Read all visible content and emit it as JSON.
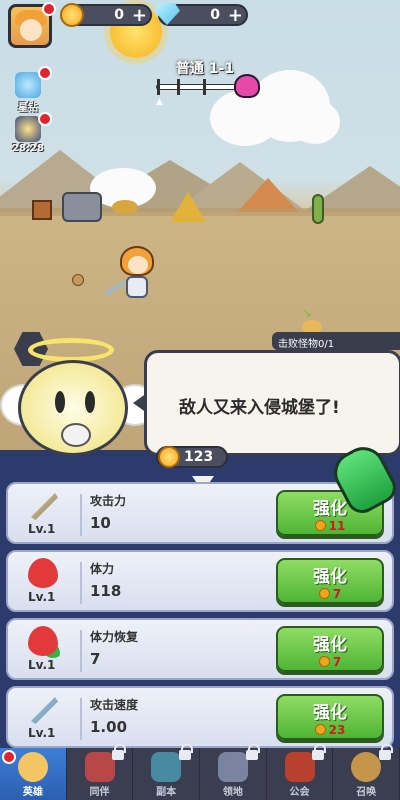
{
  "hud": {
    "gold": "0",
    "gems": "0",
    "stage": "普通 1-1",
    "side_buttons": [
      {
        "label": "星钻"
      },
      {
        "label": "28:28"
      }
    ],
    "kill_progress": "击败怪物0/1"
  },
  "dialog": {
    "text": "敌人又来入侵城堡了!"
  },
  "panel": {
    "coin_total": "123",
    "rows": [
      {
        "icon": "sword-icon",
        "level": "Lv.1",
        "name": "攻击力",
        "value": "10",
        "button": "强化",
        "cost": "11"
      },
      {
        "icon": "heart-icon",
        "level": "Lv.1",
        "name": "体力",
        "value": "118",
        "button": "强化",
        "cost": "7"
      },
      {
        "icon": "heart-regen-icon",
        "level": "Lv.1",
        "name": "体力恢复",
        "value": "7",
        "button": "强化",
        "cost": "7"
      },
      {
        "icon": "attack-speed-icon",
        "level": "Lv.1",
        "name": "攻击速度",
        "value": "1.00",
        "button": "强化",
        "cost": "23"
      }
    ]
  },
  "nav": {
    "tabs": [
      {
        "label": "英雄",
        "active": true
      },
      {
        "label": "同伴"
      },
      {
        "label": "副本"
      },
      {
        "label": "领地"
      },
      {
        "label": "公会"
      },
      {
        "label": "召唤"
      }
    ]
  },
  "colors": {
    "upgrade_green": "#4fb535",
    "cost_red": "#c81e1e",
    "panel_bg": "#2d3b6c",
    "active_tab": "#2c5fb1"
  }
}
